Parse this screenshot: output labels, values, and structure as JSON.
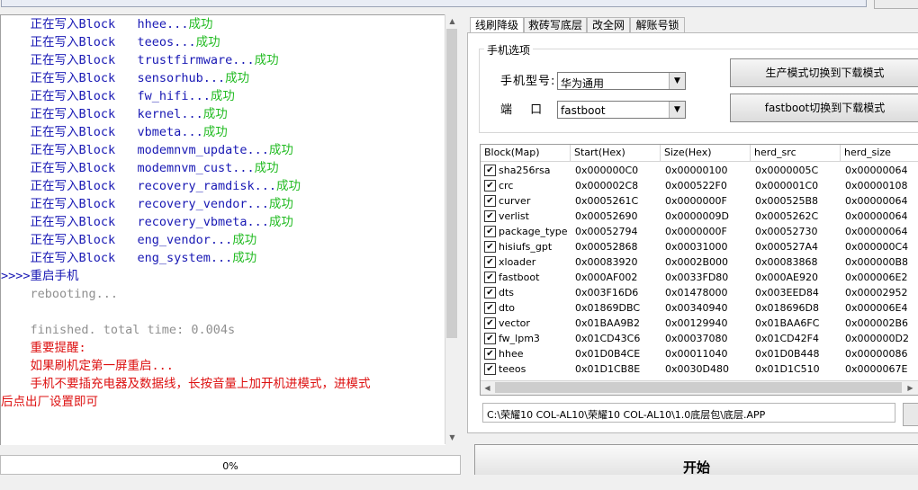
{
  "colors": {
    "writing": "#1818b4",
    "ok": "#22bb22",
    "prompt": "#1818b4",
    "grey": "#909090",
    "warn": "#dd1111"
  },
  "log": [
    {
      "parts": [
        {
          "t": "    正在写入Block   ",
          "c": "writing"
        },
        {
          "t": "hhee...",
          "c": "writing"
        },
        {
          "t": "成功",
          "c": "ok"
        }
      ]
    },
    {
      "parts": [
        {
          "t": "    正在写入Block   ",
          "c": "writing"
        },
        {
          "t": "teeos...",
          "c": "writing"
        },
        {
          "t": "成功",
          "c": "ok"
        }
      ]
    },
    {
      "parts": [
        {
          "t": "    正在写入Block   ",
          "c": "writing"
        },
        {
          "t": "trustfirmware...",
          "c": "writing"
        },
        {
          "t": "成功",
          "c": "ok"
        }
      ]
    },
    {
      "parts": [
        {
          "t": "    正在写入Block   ",
          "c": "writing"
        },
        {
          "t": "sensorhub...",
          "c": "writing"
        },
        {
          "t": "成功",
          "c": "ok"
        }
      ]
    },
    {
      "parts": [
        {
          "t": "    正在写入Block   ",
          "c": "writing"
        },
        {
          "t": "fw_hifi...",
          "c": "writing"
        },
        {
          "t": "成功",
          "c": "ok"
        }
      ]
    },
    {
      "parts": [
        {
          "t": "    正在写入Block   ",
          "c": "writing"
        },
        {
          "t": "kernel...",
          "c": "writing"
        },
        {
          "t": "成功",
          "c": "ok"
        }
      ]
    },
    {
      "parts": [
        {
          "t": "    正在写入Block   ",
          "c": "writing"
        },
        {
          "t": "vbmeta...",
          "c": "writing"
        },
        {
          "t": "成功",
          "c": "ok"
        }
      ]
    },
    {
      "parts": [
        {
          "t": "    正在写入Block   ",
          "c": "writing"
        },
        {
          "t": "modemnvm_update...",
          "c": "writing"
        },
        {
          "t": "成功",
          "c": "ok"
        }
      ]
    },
    {
      "parts": [
        {
          "t": "    正在写入Block   ",
          "c": "writing"
        },
        {
          "t": "modemnvm_cust...",
          "c": "writing"
        },
        {
          "t": "成功",
          "c": "ok"
        }
      ]
    },
    {
      "parts": [
        {
          "t": "    正在写入Block   ",
          "c": "writing"
        },
        {
          "t": "recovery_ramdisk...",
          "c": "writing"
        },
        {
          "t": "成功",
          "c": "ok"
        }
      ]
    },
    {
      "parts": [
        {
          "t": "    正在写入Block   ",
          "c": "writing"
        },
        {
          "t": "recovery_vendor...",
          "c": "writing"
        },
        {
          "t": "成功",
          "c": "ok"
        }
      ]
    },
    {
      "parts": [
        {
          "t": "    正在写入Block   ",
          "c": "writing"
        },
        {
          "t": "recovery_vbmeta...",
          "c": "writing"
        },
        {
          "t": "成功",
          "c": "ok"
        }
      ]
    },
    {
      "parts": [
        {
          "t": "    正在写入Block   ",
          "c": "writing"
        },
        {
          "t": "eng_vendor...",
          "c": "writing"
        },
        {
          "t": "成功",
          "c": "ok"
        }
      ]
    },
    {
      "parts": [
        {
          "t": "    正在写入Block   ",
          "c": "writing"
        },
        {
          "t": "eng_system...",
          "c": "writing"
        },
        {
          "t": "成功",
          "c": "ok"
        }
      ]
    },
    {
      "parts": [
        {
          "t": ">>>>",
          "c": "prompt"
        },
        {
          "t": "重启手机",
          "c": "prompt"
        }
      ]
    },
    {
      "parts": [
        {
          "t": "    rebooting...",
          "c": "grey"
        }
      ]
    },
    {
      "parts": [
        {
          "t": "",
          "c": "grey"
        }
      ]
    },
    {
      "parts": [
        {
          "t": "    finished. total time: 0.004s",
          "c": "grey"
        }
      ]
    },
    {
      "parts": [
        {
          "t": "    重要提醒:",
          "c": "warn"
        }
      ]
    },
    {
      "parts": [
        {
          "t": "    如果刷机定第一屏重启...",
          "c": "warn"
        }
      ]
    },
    {
      "parts": [
        {
          "t": "    手机不要插充电器及数据线，长按音量上加开机进模式，进模式",
          "c": "warn"
        }
      ]
    },
    {
      "parts": [
        {
          "t": "后点出厂设置即可",
          "c": "warn"
        }
      ]
    }
  ],
  "progress": {
    "label": "0%",
    "value": 0
  },
  "tabs": [
    "线刷降级",
    "救砖写底层",
    "改全网",
    "解账号锁"
  ],
  "options": {
    "group_title": "手机选项",
    "model_label": "手机型号:",
    "model_value": "华为通用",
    "port_label": "端  口",
    "port_value": "fastboot",
    "btn_prod": "生产模式切换到下载模式",
    "btn_fastboot": "fastboot切换到下载模式"
  },
  "table": {
    "headers": [
      "Block(Map)",
      "Start(Hex)",
      "Size(Hex)",
      "herd_src",
      "herd_size"
    ],
    "rows": [
      {
        "checked": true,
        "cells": [
          "sha256rsa",
          "0x000000C0",
          "0x00000100",
          "0x0000005C",
          "0x00000064"
        ]
      },
      {
        "checked": true,
        "cells": [
          "crc",
          "0x000002C8",
          "0x000522F0",
          "0x000001C0",
          "0x00000108"
        ]
      },
      {
        "checked": true,
        "cells": [
          "curver",
          "0x0005261C",
          "0x0000000F",
          "0x000525B8",
          "0x00000064"
        ]
      },
      {
        "checked": true,
        "cells": [
          "verlist",
          "0x00052690",
          "0x0000009D",
          "0x0005262C",
          "0x00000064"
        ]
      },
      {
        "checked": true,
        "cells": [
          "package_type",
          "0x00052794",
          "0x0000000F",
          "0x00052730",
          "0x00000064"
        ]
      },
      {
        "checked": true,
        "cells": [
          "hisiufs_gpt",
          "0x00052868",
          "0x00031000",
          "0x000527A4",
          "0x000000C4"
        ]
      },
      {
        "checked": true,
        "cells": [
          "xloader",
          "0x00083920",
          "0x0002B000",
          "0x00083868",
          "0x000000B8"
        ]
      },
      {
        "checked": true,
        "cells": [
          "fastboot",
          "0x000AF002",
          "0x0033FD80",
          "0x000AE920",
          "0x000006E2"
        ]
      },
      {
        "checked": true,
        "cells": [
          "dts",
          "0x003F16D6",
          "0x01478000",
          "0x003EED84",
          "0x00002952"
        ]
      },
      {
        "checked": true,
        "cells": [
          "dto",
          "0x01869DBC",
          "0x00340940",
          "0x018696D8",
          "0x000006E4"
        ]
      },
      {
        "checked": true,
        "cells": [
          "vector",
          "0x01BAA9B2",
          "0x00129940",
          "0x01BAA6FC",
          "0x000002B6"
        ]
      },
      {
        "checked": true,
        "cells": [
          "fw_lpm3",
          "0x01CD43C6",
          "0x00037080",
          "0x01CD42F4",
          "0x000000D2"
        ]
      },
      {
        "checked": true,
        "cells": [
          "hhee",
          "0x01D0B4CE",
          "0x00011040",
          "0x01D0B448",
          "0x00000086"
        ]
      },
      {
        "checked": true,
        "cells": [
          "teeos",
          "0x01D1CB8E",
          "0x0030D480",
          "0x01D1C510",
          "0x0000067E"
        ]
      }
    ]
  },
  "path": "C:\\荣耀10 COL-AL10\\荣耀10 COL-AL10\\1.0底层包\\底层.APP",
  "start_button": "开始"
}
